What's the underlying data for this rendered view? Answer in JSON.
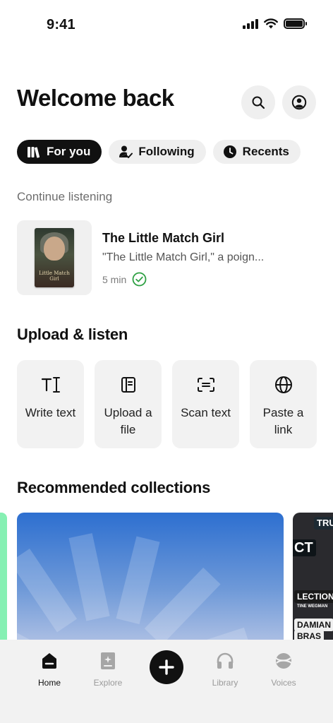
{
  "status_bar": {
    "time": "9:41"
  },
  "header": {
    "title": "Welcome back"
  },
  "tabs": [
    {
      "label": "For you",
      "icon": "books-icon"
    },
    {
      "label": "Following",
      "icon": "person-check-icon"
    },
    {
      "label": "Recents",
      "icon": "clock-icon"
    }
  ],
  "continue_listening": {
    "label": "Continue listening",
    "item": {
      "title": "The Little Match Girl",
      "excerpt": "\"The Little Match Girl,\" a poign...",
      "duration": "5 min",
      "cover_text": "Little Match Girl"
    }
  },
  "upload": {
    "title": "Upload & listen",
    "options": [
      {
        "label": "Write text",
        "icon": "text-cursor-icon"
      },
      {
        "label": "Upload a file",
        "icon": "file-icon"
      },
      {
        "label": "Scan text",
        "icon": "scan-icon"
      },
      {
        "label": "Paste a link",
        "icon": "globe-icon"
      }
    ]
  },
  "recommended": {
    "title": "Recommended collections",
    "right_card_words": [
      "TRU",
      "CT",
      "LECTION",
      "TINE WEGMAN",
      "DAMIAN",
      "BRAS"
    ]
  },
  "bottom_nav": {
    "items": [
      {
        "label": "Home",
        "icon": "home-icon"
      },
      {
        "label": "Explore",
        "icon": "explore-icon"
      },
      {
        "label": "Library",
        "icon": "headphones-icon"
      },
      {
        "label": "Voices",
        "icon": "voices-icon"
      }
    ],
    "add_icon": "plus-icon"
  },
  "colors": {
    "accent_green": "#86f0b3",
    "check_green": "#2ea043",
    "collection_blue": "#2d6fd0"
  }
}
